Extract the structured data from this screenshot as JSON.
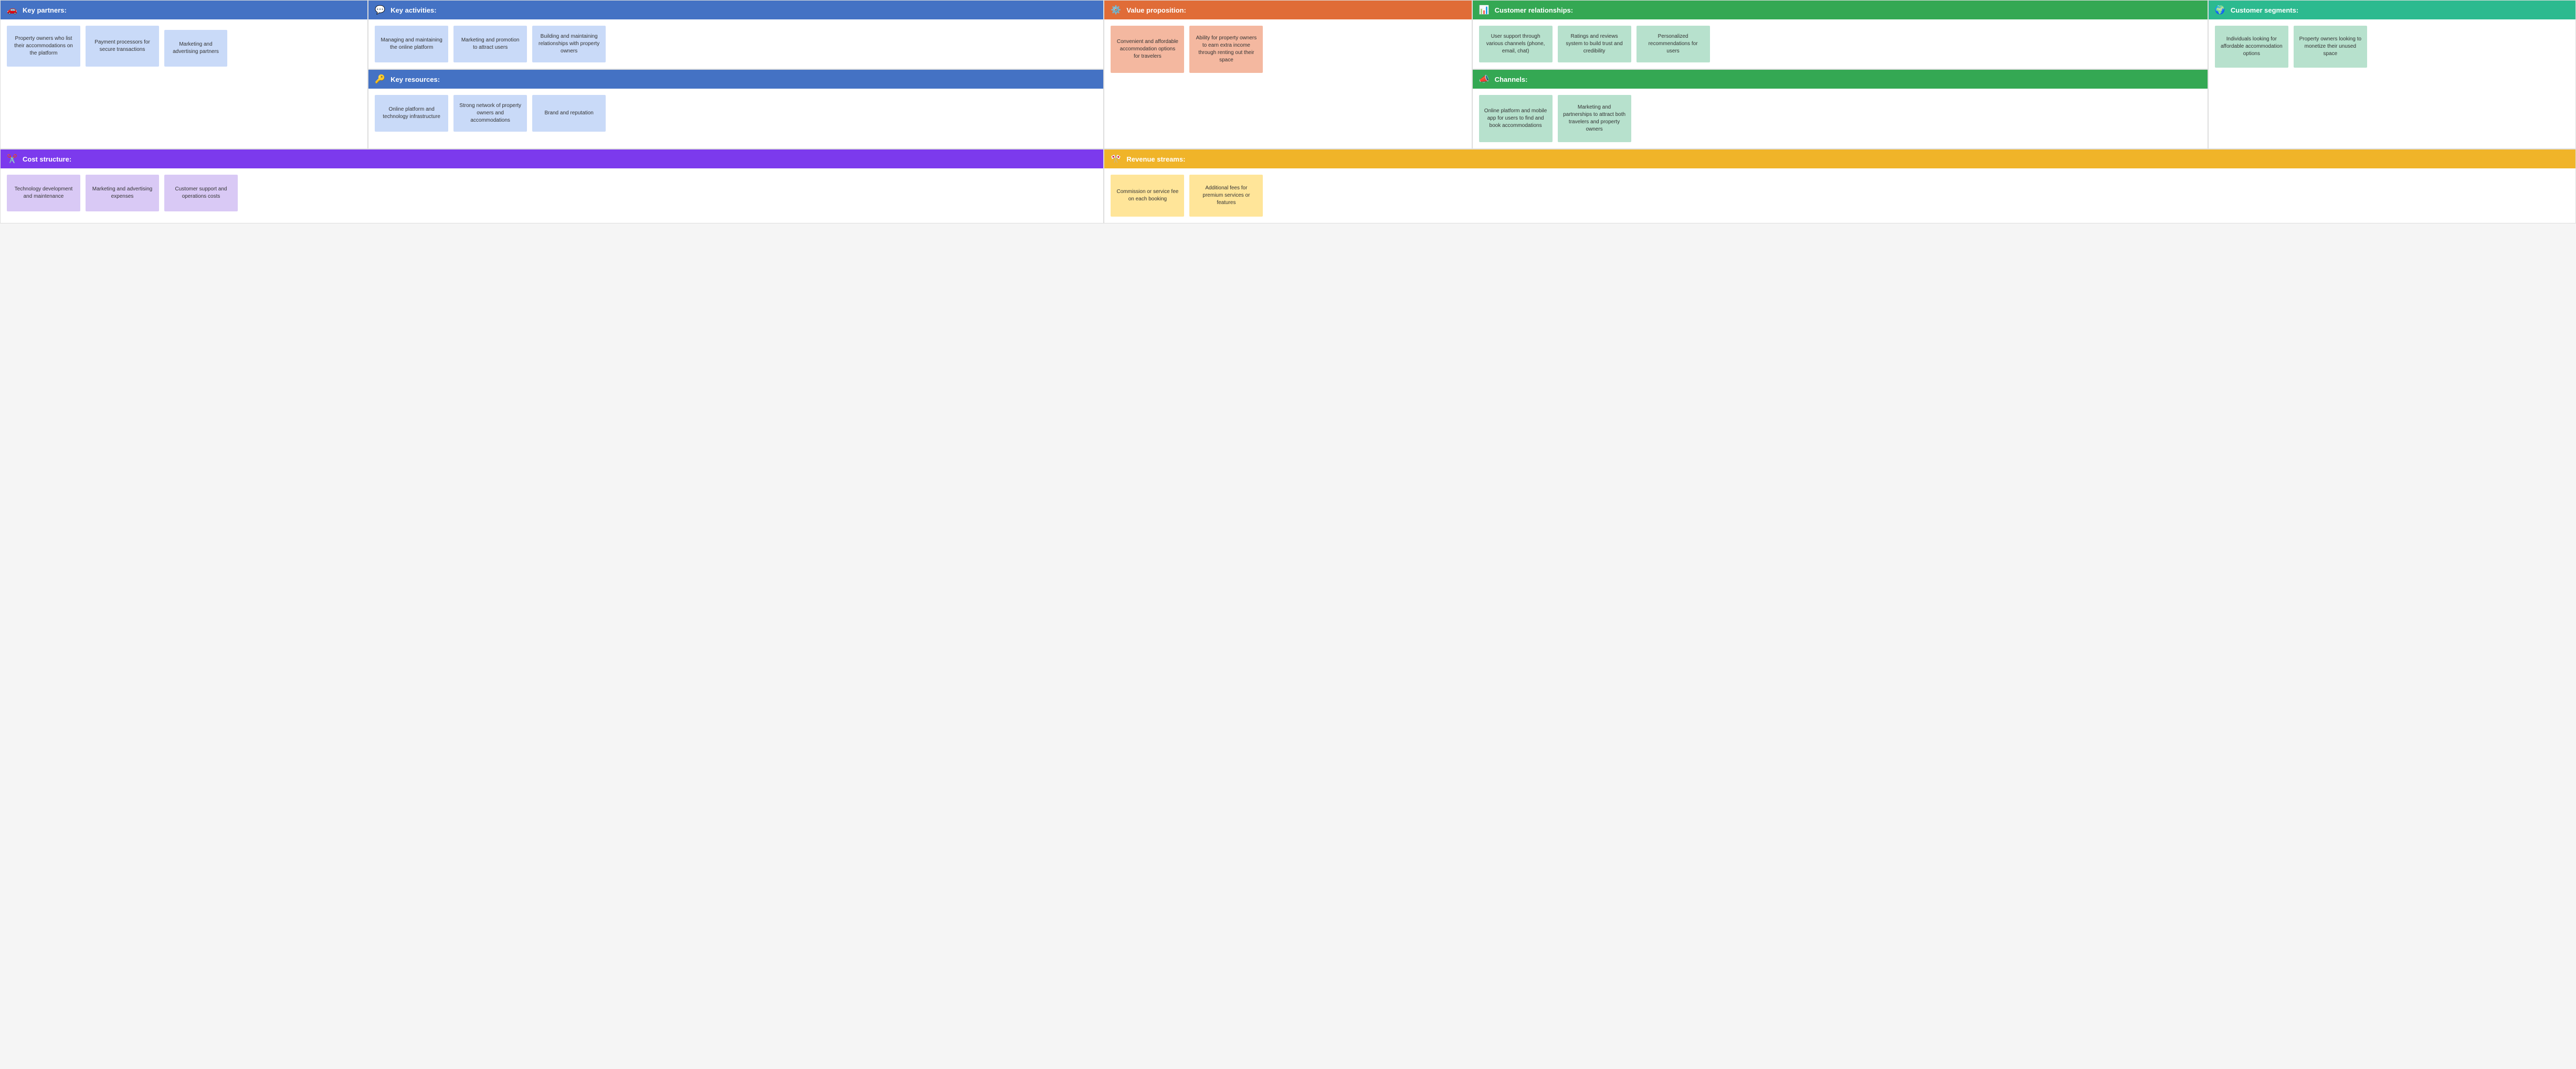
{
  "sections": {
    "keyPartners": {
      "title": "Key partners:",
      "icon": "🚗",
      "headerColor": "header-blue",
      "notes": [
        {
          "text": "Property owners who list their accommodations on the platform",
          "color": "sticky-light-blue"
        },
        {
          "text": "Payment processors for secure transactions",
          "color": "sticky-light-blue"
        },
        {
          "text": "Marketing and advertising partners",
          "color": "sticky-light-blue"
        }
      ]
    },
    "keyActivities": {
      "title": "Key activities:",
      "icon": "💬",
      "headerColor": "header-blue",
      "notes": [
        {
          "text": "Managing and maintaining the online platform",
          "color": "sticky-light-blue"
        },
        {
          "text": "Marketing and promotion to attract users",
          "color": "sticky-light-blue"
        },
        {
          "text": "Building and maintaining relationships with property owners",
          "color": "sticky-light-blue"
        }
      ]
    },
    "valueProposition": {
      "title": "Value proposition:",
      "icon": "⚙️",
      "headerColor": "header-orange",
      "notes": [
        {
          "text": "Convenient and affordable accommodation options for travelers",
          "color": "sticky-salmon"
        },
        {
          "text": "Ability for property owners to earn extra income through renting out their space",
          "color": "sticky-salmon"
        }
      ]
    },
    "customerRelationships": {
      "title": "Customer relationships:",
      "icon": "📊",
      "headerColor": "header-green",
      "notes": [
        {
          "text": "User support through various channels (phone, email, chat)",
          "color": "sticky-light-green"
        },
        {
          "text": "Ratings and reviews system to build trust and credibility",
          "color": "sticky-light-green"
        },
        {
          "text": "Personalized recommendations for users",
          "color": "sticky-light-green"
        }
      ]
    },
    "customerSegments": {
      "title": "Customer segments:",
      "icon": "🌍",
      "headerColor": "header-teal",
      "notes": [
        {
          "text": "Individuals looking for affordable accommodation options",
          "color": "sticky-light-green"
        },
        {
          "text": "Property owners looking to monetize their unused space",
          "color": "sticky-light-green"
        }
      ]
    },
    "keyResources": {
      "title": "Key resources:",
      "icon": "🔑",
      "headerColor": "header-blue",
      "notes": [
        {
          "text": "Online platform and technology infrastructure",
          "color": "sticky-light-blue"
        },
        {
          "text": "Strong network of property owners and accommodations",
          "color": "sticky-light-blue"
        },
        {
          "text": "Brand and reputation",
          "color": "sticky-light-blue"
        }
      ]
    },
    "channels": {
      "title": "Channels:",
      "icon": "📣",
      "headerColor": "header-green",
      "notes": [
        {
          "text": "Online platform and mobile app for users to find and book accommodations",
          "color": "sticky-light-green"
        },
        {
          "text": "Marketing and partnerships to attract both travelers and property owners",
          "color": "sticky-light-green"
        }
      ]
    },
    "costStructure": {
      "title": "Cost structure:",
      "icon": "✂️",
      "headerColor": "header-purple",
      "notes": [
        {
          "text": "Technology development and maintenance",
          "color": "sticky-light-purple"
        },
        {
          "text": "Marketing and advertising expenses",
          "color": "sticky-light-purple"
        },
        {
          "text": "Customer support and operations costs",
          "color": "sticky-light-purple"
        }
      ]
    },
    "revenueStreams": {
      "title": "Revenue streams:",
      "icon": "🎌",
      "headerColor": "header-yellow",
      "notes": [
        {
          "text": "Commission or service fee on each booking",
          "color": "sticky-yellow"
        },
        {
          "text": "Additional fees for premium services or features",
          "color": "sticky-yellow"
        }
      ]
    }
  }
}
